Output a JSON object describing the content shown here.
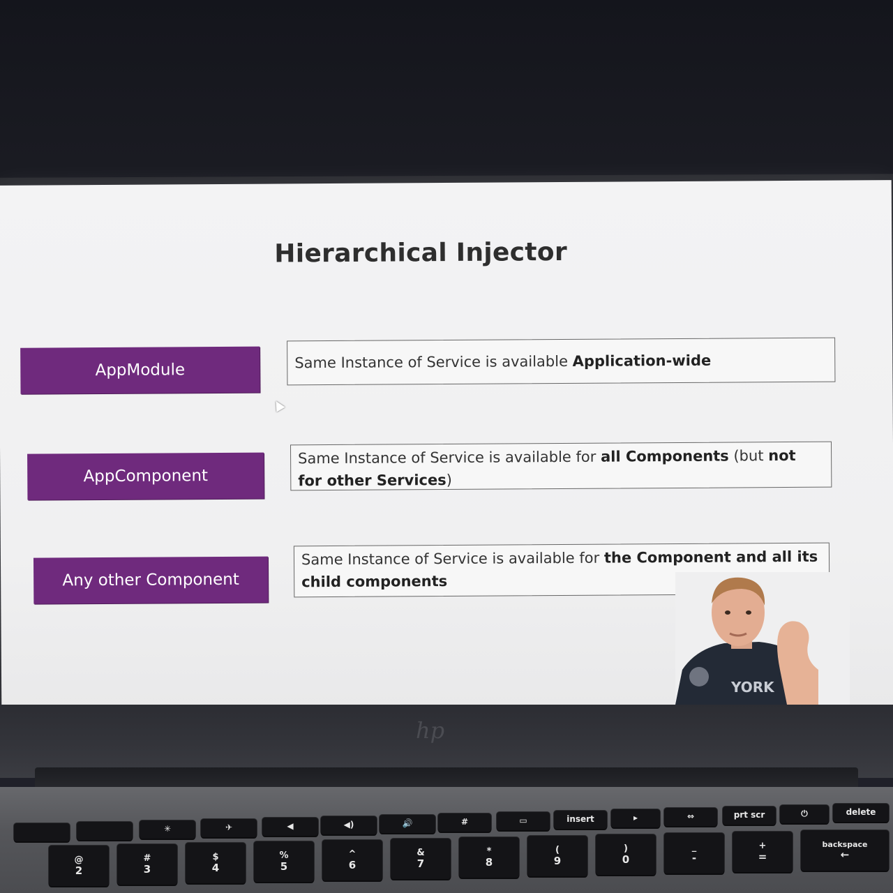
{
  "slide": {
    "title": "Hierarchical Injector",
    "rows": [
      {
        "label": "AppModule",
        "desc_parts": [
          {
            "text": "Same Instance of Service is available ",
            "bold": false
          },
          {
            "text": "Application-wide",
            "bold": true
          }
        ]
      },
      {
        "label": "AppComponent",
        "desc_parts": [
          {
            "text": "Same Instance of Service is available for ",
            "bold": false
          },
          {
            "text": "all Components",
            "bold": true
          },
          {
            "text": " (but ",
            "bold": false
          },
          {
            "text": "not for other Services",
            "bold": true
          },
          {
            "text": ")",
            "bold": false
          }
        ]
      },
      {
        "label": "Any other Component",
        "desc_parts": [
          {
            "text": "Same Instance of Service is available for ",
            "bold": false
          },
          {
            "text": "the Component and all its child components",
            "bold": true
          }
        ]
      }
    ],
    "accent_color": "#6f2a7d"
  },
  "laptop": {
    "logo": "hp",
    "keyboard": {
      "function_row": [
        "",
        "",
        "✳",
        "✈",
        "◀",
        "◀)",
        "🔊",
        "#",
        "▭",
        "insert",
        "▸",
        "⇔",
        "prt scr",
        "⏻",
        "delete"
      ],
      "number_row": [
        {
          "top": "@",
          "bot": "2"
        },
        {
          "top": "#",
          "bot": "3"
        },
        {
          "top": "$",
          "bot": "4"
        },
        {
          "top": "%",
          "bot": "5"
        },
        {
          "top": "^",
          "bot": "6"
        },
        {
          "top": "&",
          "bot": "7"
        },
        {
          "top": "*",
          "bot": "8"
        },
        {
          "top": "(",
          "bot": "9"
        },
        {
          "top": ")",
          "bot": "0"
        },
        {
          "top": "_",
          "bot": "-"
        },
        {
          "top": "+",
          "bot": "="
        },
        {
          "top": "backspace",
          "bot": "←"
        }
      ]
    }
  }
}
